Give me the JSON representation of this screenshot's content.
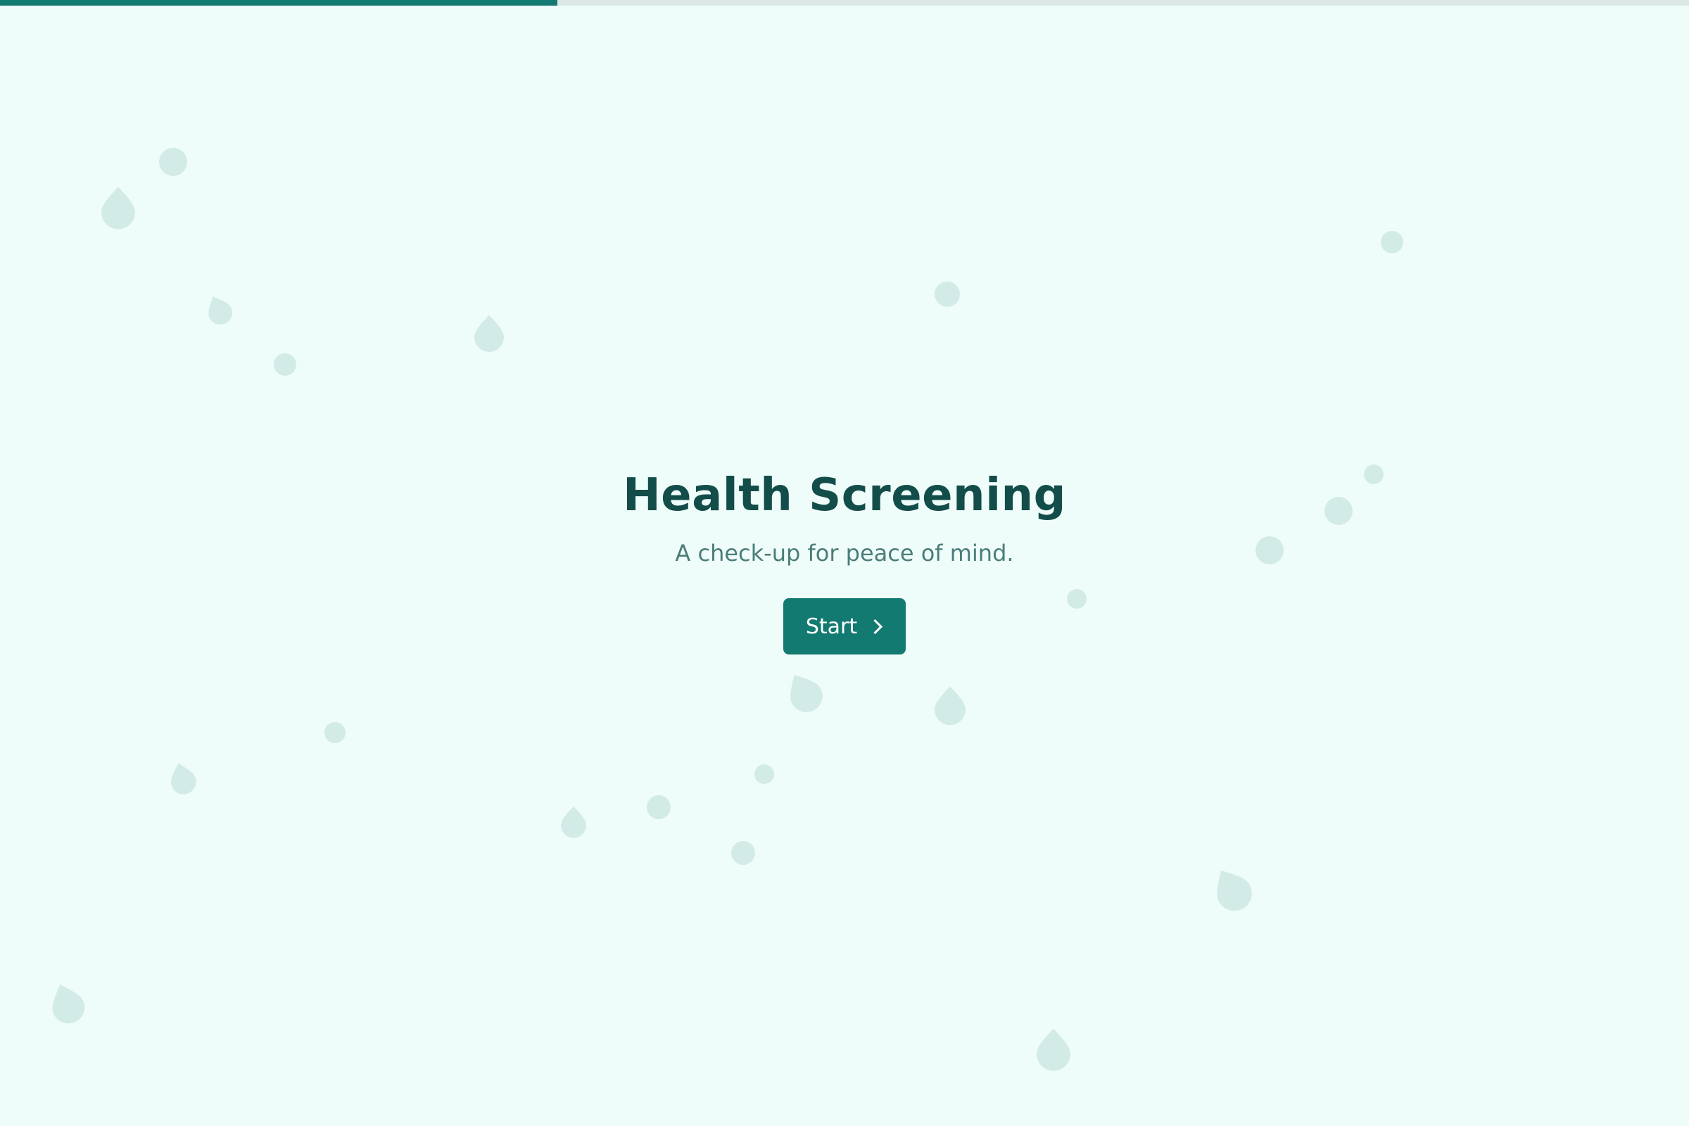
{
  "progress": {
    "fraction": 0.33
  },
  "hero": {
    "title": "Health Screening",
    "subtitle": "A check-up for peace of mind.",
    "start_label": "Start"
  },
  "colors": {
    "background": "#effdfa",
    "accent": "#137a72",
    "title": "#124d49",
    "subtitle": "#4a7d79",
    "decor": "#d3ebe6"
  },
  "icons": {
    "start_button_icon": "chevron-right-icon",
    "decor_shapes": [
      "droplet-icon",
      "circle-dot"
    ]
  }
}
